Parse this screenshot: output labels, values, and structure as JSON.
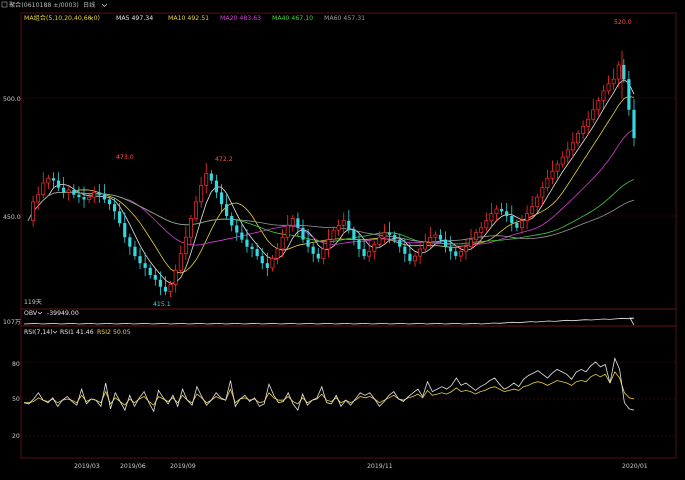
{
  "header": {
    "menu_icon": "collapse-toggle-icon",
    "symbol_label": "聚合(0610188 ±/0003)",
    "period_label": "日线",
    "dropdown_icon": "chevron-down-icon"
  },
  "price_panel": {
    "ma_group_label": "MA组合(5,10,20,40,60,0)",
    "ma_values": [
      {
        "label": "MA5 497.34",
        "color": "#e6e6e6"
      },
      {
        "label": "MA10 492.51",
        "color": "#e6d23c"
      },
      {
        "label": "MA20 483.63",
        "color": "#d040d0"
      },
      {
        "label": "MA40 467.10",
        "color": "#40d040"
      },
      {
        "label": "MA60 457.31",
        "color": "#9a9a9a"
      }
    ],
    "y_ticks": [
      "500.0",
      "450.0"
    ],
    "annotations": {
      "high_1": "473.0",
      "high_2": "472.2",
      "high_max": "520.0",
      "low_1": "415.1",
      "bottom_left": "119天"
    }
  },
  "obv_panel": {
    "label": "OBV",
    "value": "-39949.00",
    "y_label": "107万"
  },
  "rsi_panel": {
    "label": "RSI(7,14)",
    "rsi1": "RSI1 41.46",
    "rsi2": "RSI2 50.05",
    "y_ticks": [
      "80",
      "50",
      "20"
    ]
  },
  "x_axis": {
    "ticks": [
      "2019/03",
      "2019/06",
      "2019/09",
      "2019/11",
      "2020/01"
    ]
  },
  "colors": {
    "up": "#ff3030",
    "down": "#35d7e0",
    "ma5": "#e6e6e6",
    "ma10": "#e6d23c",
    "ma20": "#d040d0",
    "ma40": "#40d040",
    "ma60": "#9a9a9a",
    "grid": "#6b1414"
  },
  "chart_data": {
    "type": "candlestick",
    "x_ticks": [
      "2019/03",
      "2019/06",
      "2019/09",
      "2019/11",
      "2020/01"
    ],
    "y_ticks": [
      450.0,
      500.0
    ],
    "ylim": [
      410,
      530
    ],
    "highlighted_values": {
      "peak_high": 520.0,
      "low": 415.1,
      "local_high_1": 473.0,
      "local_high_2": 472.2
    },
    "closes": [
      448,
      456,
      459,
      464,
      466,
      465,
      462,
      460,
      461,
      459,
      458,
      457,
      458,
      460,
      459,
      457,
      455,
      452,
      447,
      441,
      437,
      433,
      430,
      428,
      425,
      423,
      420,
      418,
      421,
      427,
      434,
      441,
      449,
      456,
      463,
      468,
      465,
      460,
      455,
      450,
      446,
      443,
      440,
      437,
      436,
      433,
      430,
      428,
      432,
      436,
      441,
      446,
      449,
      445,
      440,
      437,
      434,
      432,
      436,
      440,
      444,
      446,
      448,
      444,
      440,
      436,
      433,
      435,
      438,
      441,
      443,
      442,
      440,
      437,
      434,
      431,
      433,
      436,
      439,
      441,
      442,
      440,
      437,
      435,
      433,
      435,
      437,
      440,
      443,
      445,
      448,
      451,
      453,
      452,
      450,
      447,
      445,
      448,
      451,
      454,
      458,
      462,
      466,
      469,
      472,
      475,
      478,
      481,
      485,
      488,
      491,
      495,
      499,
      503,
      506,
      508,
      514,
      508,
      495,
      483
    ],
    "rsi": {
      "rsi1": [
        47,
        46,
        50,
        55,
        49,
        47,
        51,
        44,
        49,
        52,
        48,
        45,
        58,
        46,
        50,
        49,
        44,
        63,
        42,
        55,
        48,
        41,
        53,
        44,
        51,
        56,
        47,
        40,
        57,
        51,
        46,
        53,
        44,
        58,
        49,
        45,
        60,
        52,
        45,
        49,
        55,
        51,
        49,
        65,
        44,
        50,
        53,
        48,
        51,
        44,
        46,
        62,
        53,
        47,
        48,
        55,
        46,
        41,
        54,
        45,
        49,
        51,
        60,
        47,
        46,
        53,
        44,
        49,
        45,
        50,
        55,
        53,
        55,
        50,
        44,
        48,
        53,
        56,
        50,
        48,
        52,
        55,
        58,
        52,
        64,
        56,
        58,
        60,
        58,
        61,
        67,
        61,
        63,
        60,
        57,
        60,
        62,
        65,
        67,
        62,
        58,
        60,
        63,
        60,
        66,
        69,
        71,
        73,
        70,
        67,
        71,
        74,
        72,
        70,
        66,
        72,
        74,
        72,
        77,
        80,
        76,
        78,
        63,
        83,
        74,
        47,
        42,
        41
      ],
      "rsi2": [
        47,
        47,
        48,
        51,
        49,
        48,
        50,
        47,
        49,
        50,
        49,
        47,
        53,
        48,
        50,
        49,
        47,
        56,
        46,
        51,
        48,
        45,
        50,
        47,
        50,
        52,
        48,
        45,
        52,
        50,
        48,
        51,
        47,
        53,
        49,
        47,
        54,
        51,
        47,
        49,
        52,
        50,
        49,
        58,
        47,
        50,
        51,
        49,
        50,
        47,
        48,
        55,
        51,
        49,
        49,
        52,
        48,
        46,
        51,
        47,
        49,
        50,
        54,
        49,
        48,
        51,
        47,
        49,
        47,
        49,
        52,
        51,
        52,
        50,
        47,
        49,
        51,
        53,
        50,
        49,
        51,
        52,
        54,
        51,
        57,
        53,
        54,
        55,
        54,
        56,
        59,
        56,
        57,
        56,
        54,
        56,
        57,
        59,
        60,
        58,
        56,
        57,
        58,
        57,
        60,
        61,
        63,
        64,
        63,
        61,
        63,
        65,
        64,
        63,
        61,
        64,
        65,
        64,
        68,
        70,
        68,
        70,
        63,
        72,
        67,
        55,
        51,
        50
      ]
    }
  }
}
